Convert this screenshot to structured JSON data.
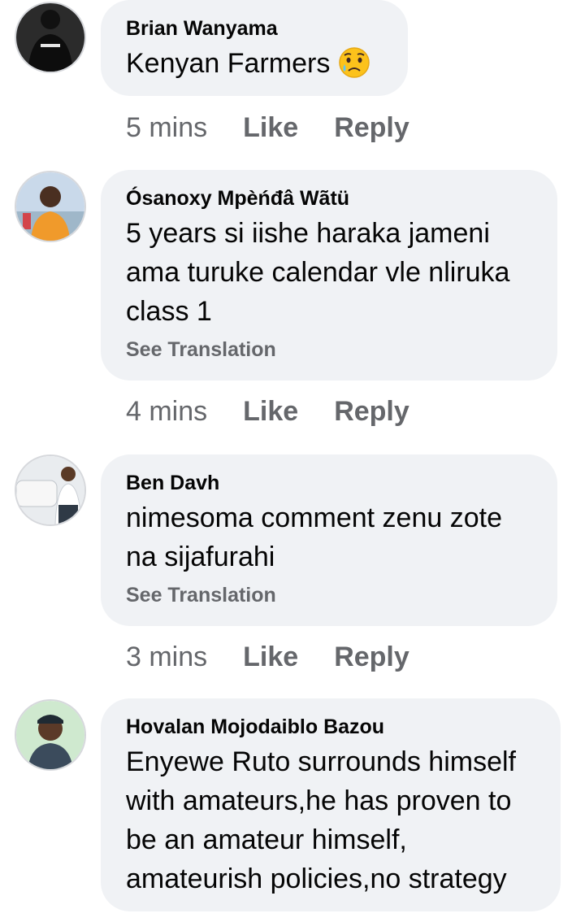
{
  "comments": [
    {
      "author": "Brian Wanyama",
      "text_lines": [
        "Kenyan Farmers"
      ],
      "emoji": "sad-tear-face",
      "time": "5 mins",
      "like_label": "Like",
      "reply_label": "Reply"
    },
    {
      "author": "Ósanoxy Mpèńđâ Wãtü",
      "text_lines": [
        "5 years si iishe haraka jameni",
        "ama turuke calendar vle nliruka",
        "class 1"
      ],
      "see_translation": "See Translation",
      "time": "4 mins",
      "like_label": "Like",
      "reply_label": "Reply"
    },
    {
      "author": "Ben Davh",
      "text_lines": [
        "nimesoma comment zenu zote",
        "na sijafurahi"
      ],
      "see_translation": "See Translation",
      "time": "3 mins",
      "like_label": "Like",
      "reply_label": "Reply"
    },
    {
      "author": "Hovalan Mojodaiblo Bazou",
      "text_lines": [
        "Enyewe Ruto surrounds himself",
        "with amateurs,he has proven to",
        "be an amateur himself,",
        "amateurish policies,no strategy"
      ]
    }
  ],
  "colors": {
    "bubble": "#f0f2f5",
    "text": "#050505",
    "muted": "#65676b"
  }
}
